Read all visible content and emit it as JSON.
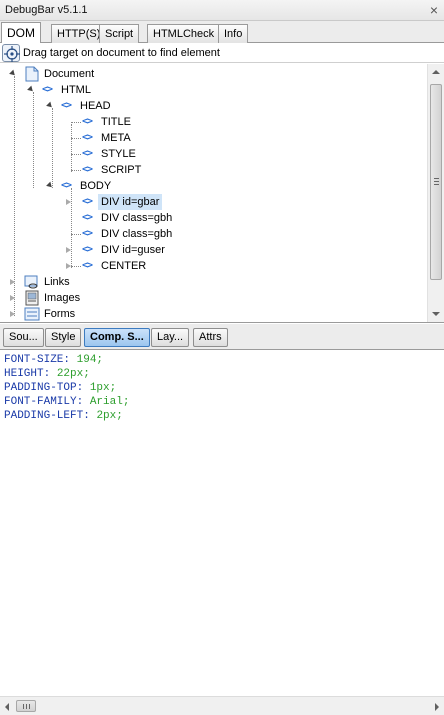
{
  "window": {
    "title": "DebugBar v5.1.1",
    "close_glyph": "×"
  },
  "tabs": [
    {
      "label": "DOM",
      "active": true
    },
    {
      "label": "HTTP(S)"
    },
    {
      "label": "Script"
    },
    {
      "label": "HTMLCheck"
    },
    {
      "label": "Info"
    }
  ],
  "toolbar": {
    "target_icon": "crosshair-target-icon",
    "hint": "Drag target on document to find element"
  },
  "tree": {
    "document": "Document",
    "html": "HTML",
    "head": "HEAD",
    "head_children": [
      "TITLE",
      "META",
      "STYLE",
      "SCRIPT"
    ],
    "body": "BODY",
    "body_children": [
      "DIV id=gbar",
      "DIV class=gbh",
      "DIV class=gbh",
      "DIV id=guser",
      "CENTER"
    ],
    "selected": "DIV id=gbar",
    "collections": [
      "Links",
      "Images",
      "Forms"
    ],
    "code_glyph": "<>"
  },
  "subtabs": [
    {
      "label": "Sou..."
    },
    {
      "label": "Style"
    },
    {
      "label": "Comp. S...",
      "active": true
    },
    {
      "label": "Lay..."
    },
    {
      "label": "Attrs"
    }
  ],
  "computed_style": [
    {
      "prop": "FONT-SIZE:",
      "value": "194;"
    },
    {
      "prop": "HEIGHT:",
      "value": "22px;"
    },
    {
      "prop": "PADDING-TOP:",
      "value": "1px;"
    },
    {
      "prop": "FONT-FAMILY:",
      "value": "Arial;"
    },
    {
      "prop": "PADDING-LEFT:",
      "value": "2px;"
    }
  ],
  "colors": {
    "accent": "#2a6fd6",
    "property": "#1a3aa8",
    "value": "#2c9e2c",
    "selection": "#cfe4f8"
  }
}
